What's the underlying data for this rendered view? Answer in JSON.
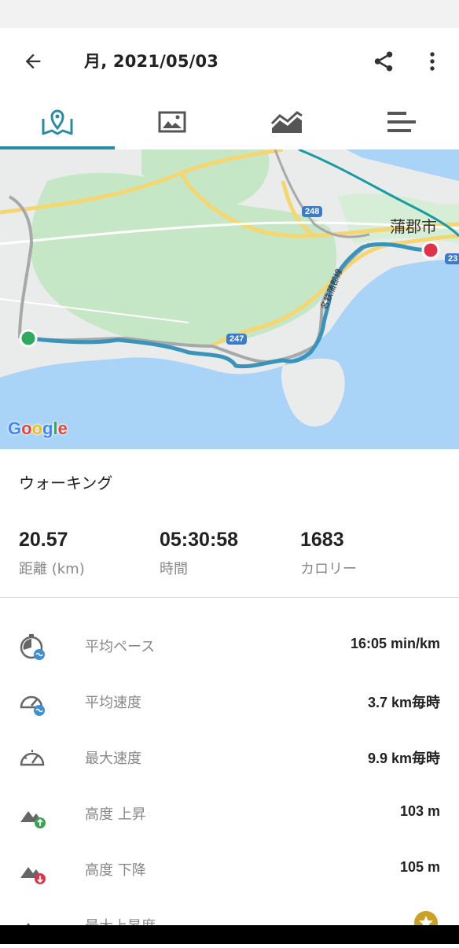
{
  "header": {
    "title": "月, 2021/05/03"
  },
  "tabs": [
    {
      "name": "map",
      "icon": "map-pin-icon"
    },
    {
      "name": "photos",
      "icon": "image-icon"
    },
    {
      "name": "charts",
      "icon": "area-chart-icon"
    },
    {
      "name": "details",
      "icon": "list-bars-icon"
    }
  ],
  "map": {
    "city": "蒲郡市",
    "road_248": "248",
    "road_247": "247",
    "road_23": "23",
    "rail_line": "名鉄蒲郡線",
    "attribution": "Google"
  },
  "activity": {
    "type": "ウォーキング"
  },
  "summary": {
    "distance_value": "20.57",
    "distance_label": "距離 (km)",
    "time_value": "05:30:58",
    "time_label": "時間",
    "calories_value": "1683",
    "calories_label": "カロリー"
  },
  "metrics": [
    {
      "label": "平均ペース",
      "value": "16:05 min/km",
      "icon": "avg-pace-icon"
    },
    {
      "label": "平均速度",
      "value": "3.7 km毎時",
      "icon": "avg-speed-icon"
    },
    {
      "label": "最大速度",
      "value": "9.9 km毎時",
      "icon": "max-speed-icon"
    },
    {
      "label": "高度 上昇",
      "value": "103 m",
      "icon": "elevation-up-icon"
    },
    {
      "label": "高度 下降",
      "value": "105 m",
      "icon": "elevation-down-icon"
    },
    {
      "label": "最大上昇度",
      "value": "",
      "icon": "max-elevation-icon"
    }
  ],
  "colors": {
    "accent": "#2a8ca3",
    "route": "#3a93b8",
    "start": "#2eaa5c",
    "end": "#e0334a",
    "water": "#aad3f8",
    "green": "#c6e7c6"
  }
}
